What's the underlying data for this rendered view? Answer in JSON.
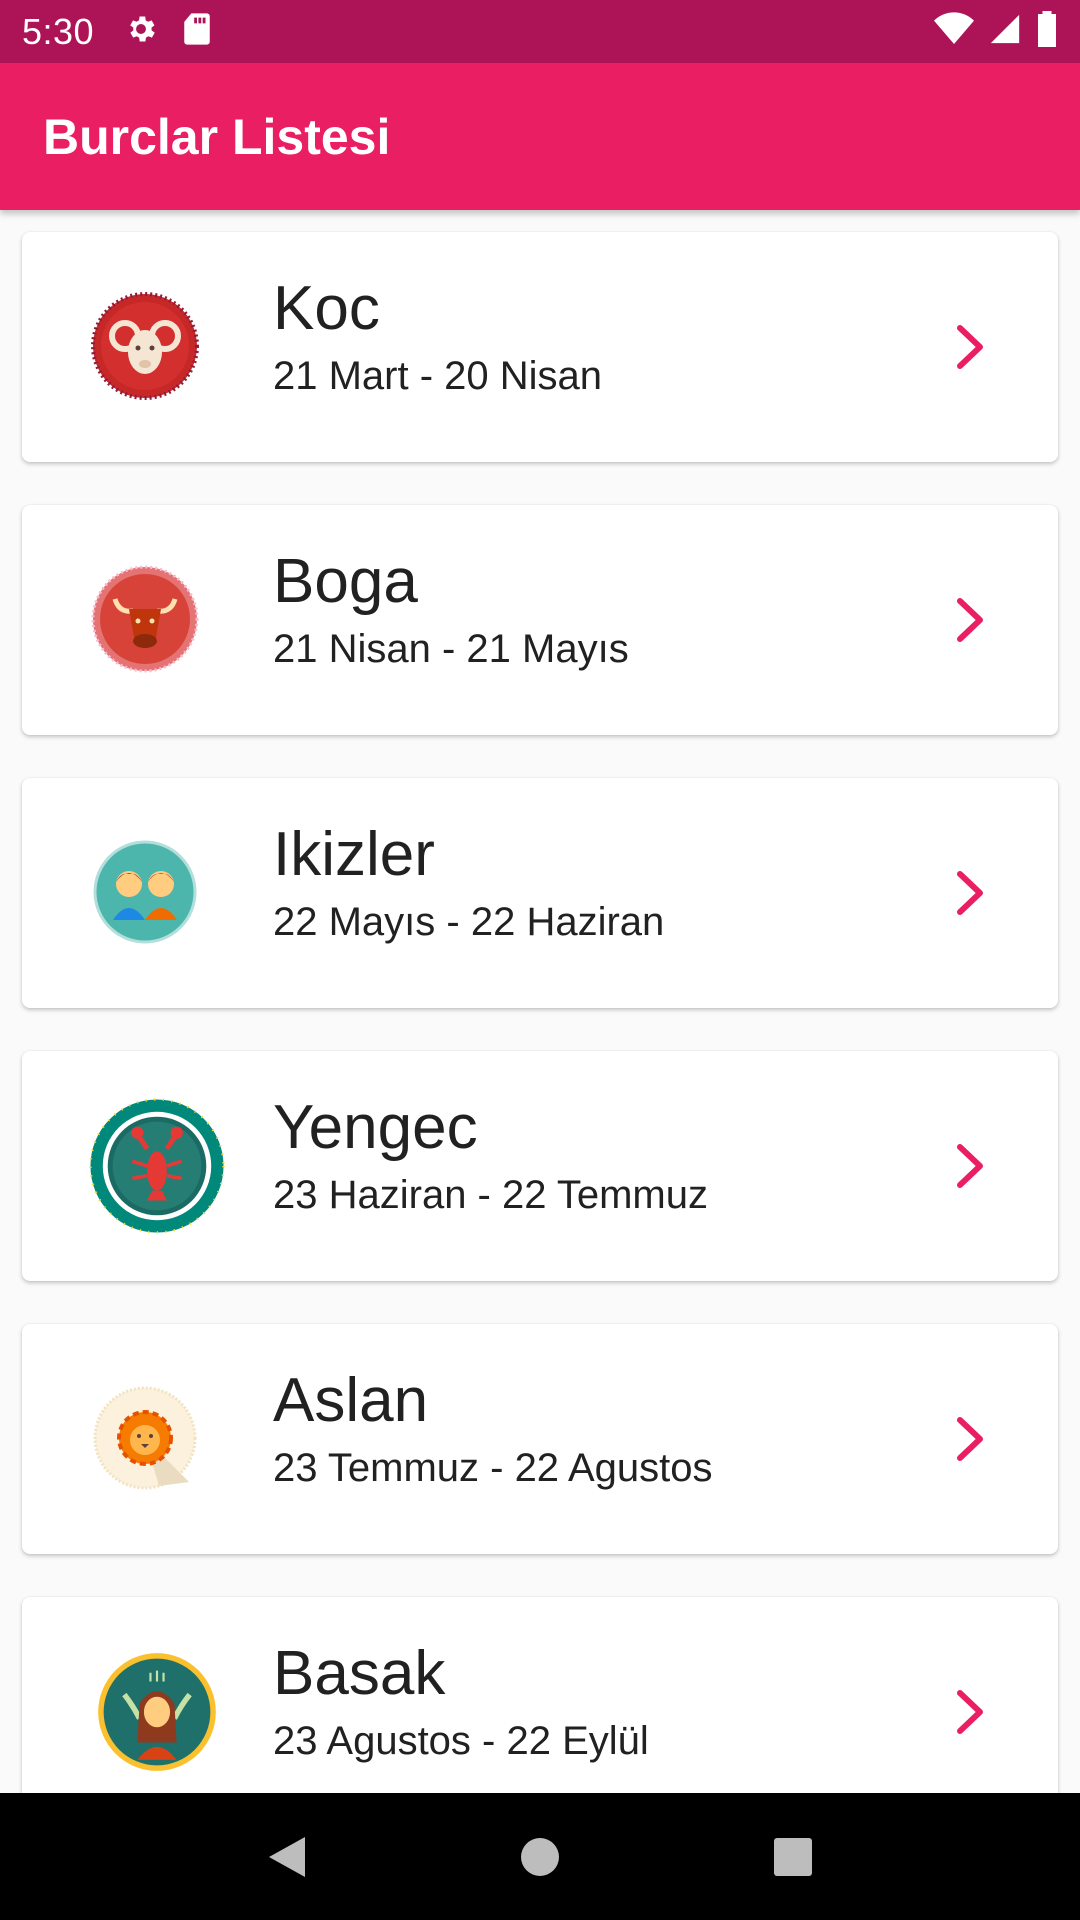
{
  "status_bar": {
    "time": "5:30",
    "icons_left": [
      "gear-icon",
      "sd-card-icon"
    ],
    "icons_right": [
      "wifi-icon",
      "signal-icon",
      "battery-icon"
    ]
  },
  "app_bar": {
    "title": "Burclar Listesi",
    "color": "#e91e63"
  },
  "accent_color": "#e91e63",
  "zodiac_list": [
    {
      "name": "Koc",
      "dates": "21 Mart - 20 Nisan",
      "icon": "aries-ram-icon"
    },
    {
      "name": "Boga",
      "dates": "21 Nisan - 21 Mayıs",
      "icon": "taurus-bull-icon"
    },
    {
      "name": "Ikizler",
      "dates": "22 Mayıs - 22 Haziran",
      "icon": "gemini-twins-icon"
    },
    {
      "name": "Yengec",
      "dates": "23 Haziran - 22 Temmuz",
      "icon": "cancer-crab-icon"
    },
    {
      "name": "Aslan",
      "dates": "23 Temmuz - 22 Agustos",
      "icon": "leo-lion-icon"
    },
    {
      "name": "Basak",
      "dates": "23 Agustos - 22 Eylül",
      "icon": "virgo-maiden-icon"
    }
  ],
  "nav_bar": {
    "buttons": [
      "back-icon",
      "home-icon",
      "recents-icon"
    ]
  }
}
